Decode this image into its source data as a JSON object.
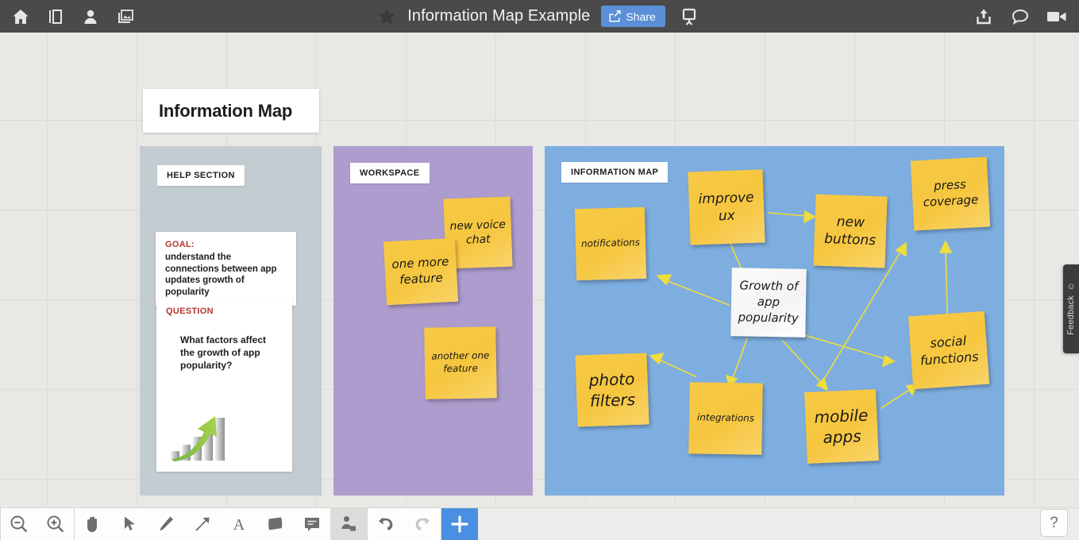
{
  "topbar": {
    "title": "Information Map Example",
    "share_label": "Share",
    "left_icons": [
      {
        "name": "home-icon"
      },
      {
        "name": "panels-icon"
      },
      {
        "name": "people-icon"
      },
      {
        "name": "images-icon"
      }
    ],
    "star_icon": "star-icon",
    "present_icon": "present-icon",
    "right_icons": [
      {
        "name": "export-icon"
      },
      {
        "name": "chat-icon"
      },
      {
        "name": "video-icon"
      }
    ]
  },
  "canvas": {
    "title_card": "Information Map",
    "panels": [
      {
        "key": "help",
        "label": "HELP SECTION",
        "color": "#c3ccd1"
      },
      {
        "key": "workspace",
        "label": "WORKSPACE",
        "color": "#ad9ccd"
      },
      {
        "key": "map",
        "label": "INFORMATION MAP",
        "color": "#7eaee0"
      }
    ],
    "help_cards": {
      "goal": {
        "kicker": "GOAL:",
        "body": "understand the connections between app updates growth of popularity"
      },
      "question": {
        "kicker": "QUESTION",
        "body": "What factors affect the growth of app popularity?",
        "illustration": "growth-chart-image"
      }
    },
    "workspace_notes": [
      {
        "text": "new voice chat"
      },
      {
        "text": "one more feature"
      },
      {
        "text": "another one feature"
      }
    ],
    "map_notes": [
      {
        "text": "notifications"
      },
      {
        "text": "improve ux"
      },
      {
        "text": "new buttons"
      },
      {
        "text": "press coverage"
      },
      {
        "text": "Growth of app popularity"
      },
      {
        "text": "social functions"
      },
      {
        "text": "photo filters"
      },
      {
        "text": "integrations"
      },
      {
        "text": "mobile apps"
      }
    ]
  },
  "feedback": {
    "label": "Feedback",
    "icon": "smiley-icon"
  },
  "bottombar": {
    "tools": [
      {
        "name": "zoom-out-icon",
        "active": false,
        "disabled": false
      },
      {
        "name": "zoom-in-icon",
        "active": false,
        "disabled": false
      },
      {
        "name": "hand-icon",
        "active": false,
        "disabled": false
      },
      {
        "name": "cursor-icon",
        "active": false,
        "disabled": false
      },
      {
        "name": "pen-icon",
        "active": false,
        "disabled": false
      },
      {
        "name": "arrow-icon",
        "active": false,
        "disabled": false
      },
      {
        "name": "text-icon",
        "active": false,
        "disabled": false
      },
      {
        "name": "sticky-note-icon",
        "active": false,
        "disabled": false
      },
      {
        "name": "comment-icon",
        "active": false,
        "disabled": false
      },
      {
        "name": "shape-person-icon",
        "active": true,
        "disabled": false
      },
      {
        "name": "undo-icon",
        "active": false,
        "disabled": false
      },
      {
        "name": "redo-icon",
        "active": false,
        "disabled": true
      }
    ],
    "add_label": "+",
    "help_label": "?"
  },
  "colors": {
    "topbar": "#4a4a4a",
    "accent_blue": "#5b8fd8",
    "sticky_yellow": "#f6c63f",
    "panel_blue": "#7eaee0",
    "panel_purple": "#ad9ccd",
    "panel_gray": "#c3ccd1",
    "kicker_red": "#b5352e",
    "arrow_yellow": "#f3e03a"
  }
}
